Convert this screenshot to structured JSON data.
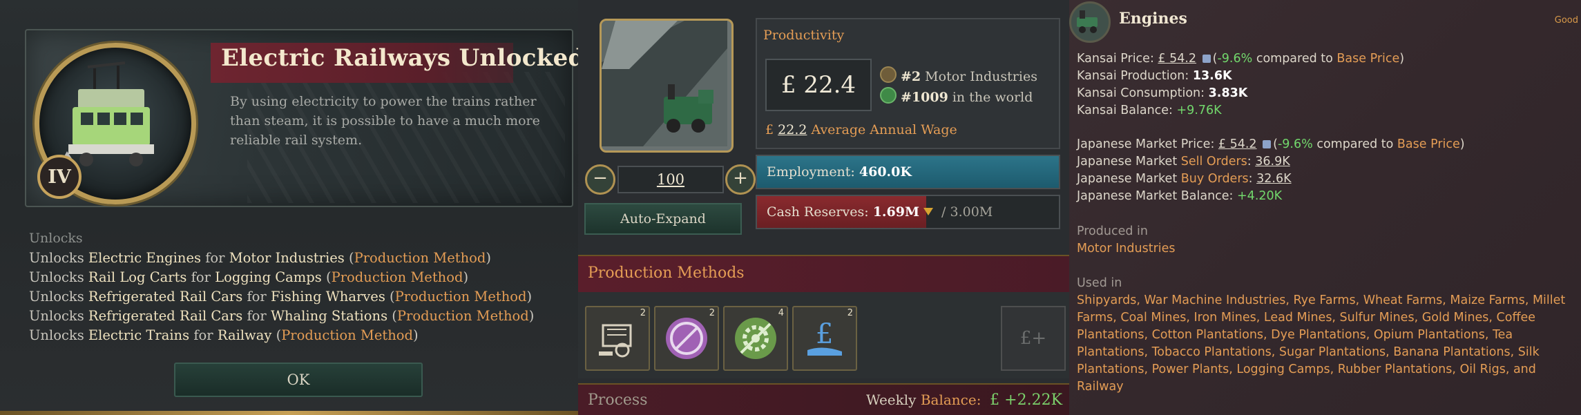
{
  "tech_popup": {
    "title": "Electric Railways Unlocked",
    "tier": "IV",
    "description": "By using electricity to power the trains rather than steam, it is possible to have a much more reliable rail system.",
    "unlocks_heading": "Unlocks",
    "unlock_lines": [
      {
        "prefix": "Unlocks ",
        "item": "Electric Engines",
        "mid": " for ",
        "target": "Motor Industries",
        "open": " (",
        "pm": "Production Method",
        "close": ")"
      },
      {
        "prefix": "Unlocks ",
        "item": "Rail Log Carts",
        "mid": " for ",
        "target": "Logging Camps",
        "open": " (",
        "pm": "Production Method",
        "close": ")"
      },
      {
        "prefix": "Unlocks ",
        "item": "Refrigerated Rail Cars",
        "mid": " for ",
        "target": "Fishing Wharves",
        "open": " (",
        "pm": "Production Method",
        "close": ")"
      },
      {
        "prefix": "Unlocks ",
        "item": "Refrigerated Rail Cars",
        "mid": " for ",
        "target": "Whaling Stations",
        "open": " (",
        "pm": "Production Method",
        "close": ")"
      },
      {
        "prefix": "Unlocks ",
        "item": "Electric Trains",
        "mid": " for ",
        "target": "Railway",
        "open": " (",
        "pm": "Production Method",
        "close": ")"
      }
    ],
    "ok_label": "OK"
  },
  "building": {
    "productivity_label": "Productivity",
    "productivity_value": "£ 22.4",
    "rank_national": "#2",
    "rank_national_label": " Motor Industries",
    "rank_world": "#1009",
    "rank_world_label": " in the world",
    "wage_symbol": "£ ",
    "wage_value": "22.2",
    "wage_label": " Average Annual Wage",
    "minus": "−",
    "plus": "+",
    "quantity": "100",
    "auto_expand": "Auto-Expand",
    "employment_label": "Employment: ",
    "employment_value": "460.0K",
    "employment_fill": 1.0,
    "cash_label": "Cash Reserves: ",
    "cash_value": "1.69M",
    "cash_max": " / 3.00M",
    "cash_fill": 0.56,
    "pm_header": "Production Methods",
    "pm_slots": [
      {
        "icon": "electric-engine-icon",
        "count": "2"
      },
      {
        "icon": "no-automation-icon",
        "count": "2"
      },
      {
        "icon": "gear-icon",
        "count": "4"
      },
      {
        "icon": "privately-owned-icon",
        "count": "2"
      }
    ],
    "pm_add": "£+",
    "process_label": "Process",
    "weekly_label": "Weekly ",
    "balance_label": "Balance:",
    "balance_value": "£ +2.22K"
  },
  "goods_tooltip": {
    "name": "Engines",
    "status": "Good",
    "state": "Kansai",
    "market": "Japanese Market",
    "price_label": " Price: ",
    "price_value": "£ 54.2",
    "price_change": "-9.6%",
    "compared_to": " compared to ",
    "base_price": "Base Price",
    "production_label": " Production: ",
    "production_value": "13.6K",
    "consumption_label": " Consumption: ",
    "consumption_value": "3.83K",
    "balance_label": " Balance: ",
    "state_balance": "+9.76K",
    "sell_orders_label": "Sell Orders",
    "sell_orders_value": "36.9K",
    "buy_orders_label": "Buy Orders",
    "buy_orders_value": "32.6K",
    "market_balance": "+4.20K",
    "produced_in_label": "Produced in",
    "produced_in": "Motor Industries",
    "used_in_label": "Used in",
    "used_in": "Shipyards, War Machine Industries, Rye Farms, Wheat Farms, Maize Farms, Millet Farms, Coal Mines, Iron Mines, Lead Mines, Sulfur Mines, Gold Mines, Coffee Plantations, Cotton Plantations, Dye Plantations, Opium Plantations, Tea Plantations, Tobacco Plantations, Sugar Plantations, Banana Plantations, Silk Plantations, Power Plants, Logging Camps, Rubber Plantations, Oil Rigs, and Railway",
    "colors": {
      "accent": "#e49d55",
      "positive": "#72d86c"
    }
  }
}
